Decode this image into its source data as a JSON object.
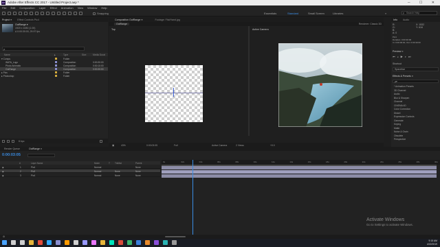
{
  "window": {
    "title": "Adobe After Effects CC 2017 - Untitled Project.aep *",
    "controls": "─ ☐ ✕"
  },
  "menu": [
    "File",
    "Edit",
    "Composition",
    "Layer",
    "Effect",
    "Animation",
    "View",
    "Window",
    "Help"
  ],
  "toolbar": {
    "snapping": "Snapping",
    "workspaces": [
      {
        "label": "Essentials",
        "active": false
      },
      {
        "label": "Standard",
        "active": true
      },
      {
        "label": "Small Screen",
        "active": false
      },
      {
        "label": "Libraries",
        "active": false
      }
    ],
    "more": "»",
    "search_placeholder": "Search Help"
  },
  "project": {
    "tabs": [
      "Project ≡",
      "Effect Controls Pic4"
    ],
    "selected_name": "OutRange ▾",
    "info_lines": [
      "1920 x 1080 (1.00)",
      "Δ 0:00:30:00, 29.97 fps"
    ],
    "columns": [
      "Name",
      "▲",
      "Type",
      "Size",
      "Media Durat"
    ],
    "rows": [
      {
        "name": "▾ Comps",
        "type": "Folder",
        "size": "",
        "dur": "",
        "color": "#d1a93d",
        "indent": 2,
        "selected": false
      },
      {
        "name": "WATA_Logo",
        "type": "Composition",
        "size": "",
        "dur": "0:00:30:00",
        "color": "#8a8fd0",
        "indent": 8,
        "selected": false
      },
      {
        "name": "Photo Animatio",
        "type": "Composition",
        "size": "",
        "dur": "0:00:10:00",
        "color": "#8a8fd0",
        "indent": 8,
        "selected": false
      },
      {
        "name": "OutRange",
        "type": "Composition",
        "size": "",
        "dur": "0:00:30:00",
        "color": "#8a8fd0",
        "indent": 8,
        "selected": true
      },
      {
        "name": "▸ Pics",
        "type": "Folder",
        "size": "",
        "dur": "",
        "color": "#d1a93d",
        "indent": 2,
        "selected": false
      },
      {
        "name": "▸ Photoshop",
        "type": "Folder",
        "size": "",
        "dur": "",
        "color": "#d1a93d",
        "indent": 2,
        "selected": false
      }
    ],
    "footer_label": "8 bpc"
  },
  "composition": {
    "tabs": [
      "Composition OutRange ≡",
      "Footage: Fitz/Hand.jpg"
    ],
    "active_subtab": "OutRange",
    "left_view_label": "Top",
    "right_view_label": "Active Camera",
    "renderer": "Renderer:  Classic 3D",
    "footer": [
      "43%",
      "0:00:03:05",
      "Full",
      "Active Camera",
      "2 Views",
      "+0.0"
    ]
  },
  "right_panel": {
    "info_tabs": [
      "Info",
      "Audio"
    ],
    "info_lines": [
      "R:",
      "G:",
      "B:",
      "A: 0"
    ],
    "info_pos": [
      "X: 1532",
      "Y: 616",
      "Pic4",
      "Duration: 0:00:30:00",
      "In: 0:00:00:00, Out: 0:00:30:00"
    ],
    "preview_label": "Preview ≡",
    "shortcut_label": "Shortcut",
    "shortcut_value": "Spacebar",
    "effects_label": "Effects & Presets ≡",
    "effects_search": "ρ▾",
    "effects": [
      "* Animation Presets",
      "3D Channel",
      "Audio",
      "Blur & Sharpen",
      "Channel",
      "CINEMA 4D",
      "Color Correction",
      "Distort",
      "Expression Controls",
      "Generate",
      "Keying",
      "Matte",
      "Noise & Grain",
      "Obsolete",
      "Perspective"
    ]
  },
  "timeline": {
    "tabs": [
      "Render Queue",
      "OutRange ≡"
    ],
    "timecode": "0:00:03:05",
    "columns": [
      "#",
      "Layer Name",
      "Mode",
      "T",
      "TrkMat",
      "Parent"
    ],
    "layers": [
      {
        "num": "1",
        "name": "Pic4",
        "mode": "Normal",
        "trk": "",
        "parent": "None",
        "selected": false
      },
      {
        "num": "2",
        "name": "Pic3",
        "mode": "Normal",
        "trk": "None",
        "parent": "None",
        "selected": true
      },
      {
        "num": "3",
        "name": "Pic4",
        "mode": "Normal",
        "trk": "None",
        "parent": "None",
        "selected": false
      }
    ],
    "ruler_ticks": [
      "0s",
      "02s",
      "04s",
      "06s",
      "08s",
      "10s",
      "12s",
      "14s",
      "16s",
      "18s",
      "20s",
      "22s",
      "24s",
      "26s",
      "28s",
      "30s"
    ],
    "watermark_title": "Activate Windows",
    "watermark_sub": "Go to Settings to activate Windows."
  },
  "taskbar": {
    "time": "9:15 AM",
    "date": "4/22/2019",
    "icons": [
      {
        "name": "windows-start-icon",
        "color": "#4aa3ff"
      },
      {
        "name": "search-icon",
        "color": "#cfcfcf"
      },
      {
        "name": "task-view-icon",
        "color": "#cfcfcf"
      },
      {
        "name": "file-explorer-icon",
        "color": "#e7b53b"
      },
      {
        "name": "chrome-icon",
        "color": "#e44c3a"
      },
      {
        "name": "photoshop-icon",
        "color": "#31a8ff"
      },
      {
        "name": "media-encoder-icon",
        "color": "#8a8fd0"
      },
      {
        "name": "illustrator-icon",
        "color": "#ff9a00"
      },
      {
        "name": "media-player-icon",
        "color": "#cfcfcf"
      },
      {
        "name": "after-effects-icon",
        "color": "#9999ff"
      },
      {
        "name": "premiere-icon",
        "color": "#ea77ff"
      },
      {
        "name": "folder-icon",
        "color": "#e7b53b"
      },
      {
        "name": "audition-icon",
        "color": "#00e4bb"
      },
      {
        "name": "app-icon-red",
        "color": "#d94b3a"
      },
      {
        "name": "app-icon-green",
        "color": "#3ab36b"
      },
      {
        "name": "app-icon-blue",
        "color": "#3a7fd9"
      },
      {
        "name": "app-icon-orange",
        "color": "#e88a2a"
      },
      {
        "name": "app-icon-purple",
        "color": "#8a4fd9"
      },
      {
        "name": "app-icon-teal",
        "color": "#2ab3b3"
      },
      {
        "name": "app-icon-gray",
        "color": "#9a9a9a"
      }
    ]
  },
  "colors": {
    "accent": "#3a8ee6",
    "panel": "#232323",
    "layer_bar": "#8c8ca6",
    "label_folder": "#d1a93d",
    "label_comp": "#8a8fd0"
  }
}
